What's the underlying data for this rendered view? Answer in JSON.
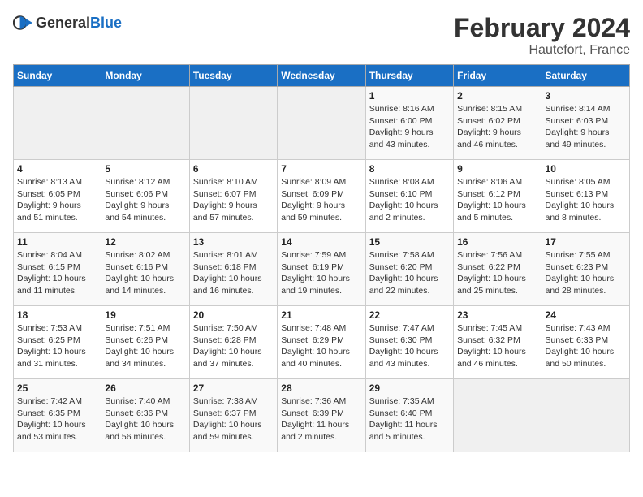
{
  "header": {
    "logo_general": "General",
    "logo_blue": "Blue",
    "title": "February 2024",
    "subtitle": "Hautefort, France"
  },
  "days_of_week": [
    "Sunday",
    "Monday",
    "Tuesday",
    "Wednesday",
    "Thursday",
    "Friday",
    "Saturday"
  ],
  "weeks": [
    [
      {
        "day": "",
        "info": ""
      },
      {
        "day": "",
        "info": ""
      },
      {
        "day": "",
        "info": ""
      },
      {
        "day": "",
        "info": ""
      },
      {
        "day": "1",
        "info": "Sunrise: 8:16 AM\nSunset: 6:00 PM\nDaylight: 9 hours\nand 43 minutes."
      },
      {
        "day": "2",
        "info": "Sunrise: 8:15 AM\nSunset: 6:02 PM\nDaylight: 9 hours\nand 46 minutes."
      },
      {
        "day": "3",
        "info": "Sunrise: 8:14 AM\nSunset: 6:03 PM\nDaylight: 9 hours\nand 49 minutes."
      }
    ],
    [
      {
        "day": "4",
        "info": "Sunrise: 8:13 AM\nSunset: 6:05 PM\nDaylight: 9 hours\nand 51 minutes."
      },
      {
        "day": "5",
        "info": "Sunrise: 8:12 AM\nSunset: 6:06 PM\nDaylight: 9 hours\nand 54 minutes."
      },
      {
        "day": "6",
        "info": "Sunrise: 8:10 AM\nSunset: 6:07 PM\nDaylight: 9 hours\nand 57 minutes."
      },
      {
        "day": "7",
        "info": "Sunrise: 8:09 AM\nSunset: 6:09 PM\nDaylight: 9 hours\nand 59 minutes."
      },
      {
        "day": "8",
        "info": "Sunrise: 8:08 AM\nSunset: 6:10 PM\nDaylight: 10 hours\nand 2 minutes."
      },
      {
        "day": "9",
        "info": "Sunrise: 8:06 AM\nSunset: 6:12 PM\nDaylight: 10 hours\nand 5 minutes."
      },
      {
        "day": "10",
        "info": "Sunrise: 8:05 AM\nSunset: 6:13 PM\nDaylight: 10 hours\nand 8 minutes."
      }
    ],
    [
      {
        "day": "11",
        "info": "Sunrise: 8:04 AM\nSunset: 6:15 PM\nDaylight: 10 hours\nand 11 minutes."
      },
      {
        "day": "12",
        "info": "Sunrise: 8:02 AM\nSunset: 6:16 PM\nDaylight: 10 hours\nand 14 minutes."
      },
      {
        "day": "13",
        "info": "Sunrise: 8:01 AM\nSunset: 6:18 PM\nDaylight: 10 hours\nand 16 minutes."
      },
      {
        "day": "14",
        "info": "Sunrise: 7:59 AM\nSunset: 6:19 PM\nDaylight: 10 hours\nand 19 minutes."
      },
      {
        "day": "15",
        "info": "Sunrise: 7:58 AM\nSunset: 6:20 PM\nDaylight: 10 hours\nand 22 minutes."
      },
      {
        "day": "16",
        "info": "Sunrise: 7:56 AM\nSunset: 6:22 PM\nDaylight: 10 hours\nand 25 minutes."
      },
      {
        "day": "17",
        "info": "Sunrise: 7:55 AM\nSunset: 6:23 PM\nDaylight: 10 hours\nand 28 minutes."
      }
    ],
    [
      {
        "day": "18",
        "info": "Sunrise: 7:53 AM\nSunset: 6:25 PM\nDaylight: 10 hours\nand 31 minutes."
      },
      {
        "day": "19",
        "info": "Sunrise: 7:51 AM\nSunset: 6:26 PM\nDaylight: 10 hours\nand 34 minutes."
      },
      {
        "day": "20",
        "info": "Sunrise: 7:50 AM\nSunset: 6:28 PM\nDaylight: 10 hours\nand 37 minutes."
      },
      {
        "day": "21",
        "info": "Sunrise: 7:48 AM\nSunset: 6:29 PM\nDaylight: 10 hours\nand 40 minutes."
      },
      {
        "day": "22",
        "info": "Sunrise: 7:47 AM\nSunset: 6:30 PM\nDaylight: 10 hours\nand 43 minutes."
      },
      {
        "day": "23",
        "info": "Sunrise: 7:45 AM\nSunset: 6:32 PM\nDaylight: 10 hours\nand 46 minutes."
      },
      {
        "day": "24",
        "info": "Sunrise: 7:43 AM\nSunset: 6:33 PM\nDaylight: 10 hours\nand 50 minutes."
      }
    ],
    [
      {
        "day": "25",
        "info": "Sunrise: 7:42 AM\nSunset: 6:35 PM\nDaylight: 10 hours\nand 53 minutes."
      },
      {
        "day": "26",
        "info": "Sunrise: 7:40 AM\nSunset: 6:36 PM\nDaylight: 10 hours\nand 56 minutes."
      },
      {
        "day": "27",
        "info": "Sunrise: 7:38 AM\nSunset: 6:37 PM\nDaylight: 10 hours\nand 59 minutes."
      },
      {
        "day": "28",
        "info": "Sunrise: 7:36 AM\nSunset: 6:39 PM\nDaylight: 11 hours\nand 2 minutes."
      },
      {
        "day": "29",
        "info": "Sunrise: 7:35 AM\nSunset: 6:40 PM\nDaylight: 11 hours\nand 5 minutes."
      },
      {
        "day": "",
        "info": ""
      },
      {
        "day": "",
        "info": ""
      }
    ]
  ]
}
